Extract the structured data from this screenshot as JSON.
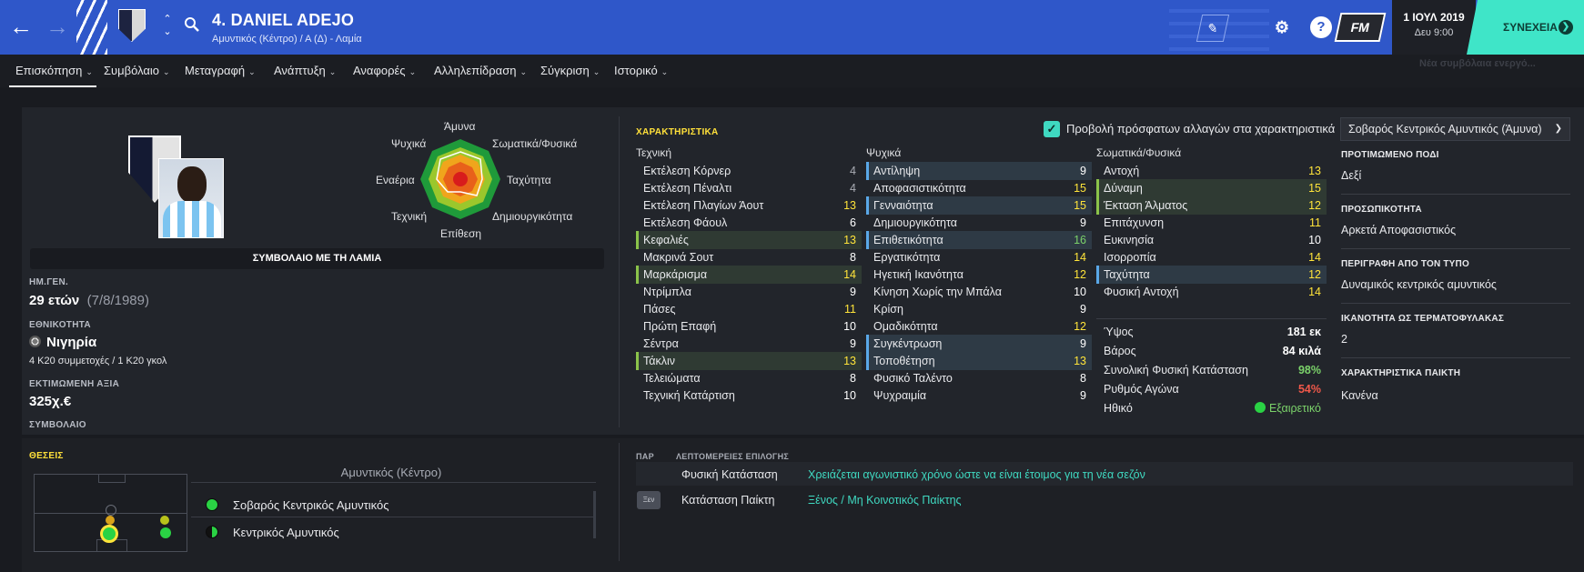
{
  "header": {
    "player_title": "4. DANIEL ADEJO",
    "subtitle": "Αμυντικός (Κέντρο) / Α (Δ) - Λαμία",
    "date": "1 ΙΟΥΛ 2019",
    "time": "Δευ 9:00",
    "continue_label": "ΣΥΝΕΧΕΙΑ",
    "fm_label": "FM",
    "help_label": "?",
    "notification": "Νέα συμβόλαια ενεργό..."
  },
  "tabs": [
    {
      "label": "Επισκόπηση"
    },
    {
      "label": "Συμβόλαιο"
    },
    {
      "label": "Μεταγραφή"
    },
    {
      "label": "Ανάπτυξη"
    },
    {
      "label": "Αναφορές"
    },
    {
      "label": "Αλληλεπίδραση"
    },
    {
      "label": "Σύγκριση"
    },
    {
      "label": "Ιστορικό"
    }
  ],
  "radar": {
    "labels": {
      "top": "Άμυνα",
      "top_right": "Σωματικά/Φυσικά",
      "right": "Ταχύτητα",
      "bottom_right": "Δημιουργικότητα",
      "bottom": "Επίθεση",
      "bottom_left": "Τεχνική",
      "left": "Εναέρια",
      "top_left": "Ψυχικά"
    }
  },
  "profile": {
    "contract_bar": "ΣΥΜΒΟΛΑΙΟ ΜΕ ΤΗ ΛΑΜΙΑ",
    "dob_label": "ΗΜ.ΓΕΝ.",
    "age": "29 ετών",
    "dob": "(7/8/1989)",
    "nationality_label": "ΕΘΝΙΚΟΤΗΤΑ",
    "nationality": "Νιγηρία",
    "caps": "4 Κ20 συμμετοχές / 1 Κ20 γκολ",
    "value_label": "ΕΚΤΙΜΩΜΕΝΗ ΑΞΙΑ",
    "value": "325χ.€",
    "contract_label": "ΣΥΜΒΟΛΑΙΟ"
  },
  "attributes": {
    "section_title": "ΧΑΡΑΚΤΗΡΙΣΤΙΚΑ",
    "show_changes_label": "Προβολή πρόσφατων αλλαγών στα χαρακτηριστικά",
    "role_select": "Σοβαρός Κεντρικός Αμυντικός (Άμυνα)",
    "technical_header": "Τεχνική",
    "mental_header": "Ψυχικά",
    "physical_header": "Σωματικά/Φυσικά",
    "technical": [
      {
        "name": "Εκτέλεση Κόρνερ",
        "value": "4"
      },
      {
        "name": "Εκτέλεση Πέναλτι",
        "value": "4"
      },
      {
        "name": "Εκτέλεση Πλαγίων Άουτ",
        "value": "13"
      },
      {
        "name": "Εκτέλεση Φάουλ",
        "value": "6"
      },
      {
        "name": "Κεφαλιές",
        "value": "13"
      },
      {
        "name": "Μακρινά Σουτ",
        "value": "8"
      },
      {
        "name": "Μαρκάρισμα",
        "value": "14"
      },
      {
        "name": "Ντρίμπλα",
        "value": "9"
      },
      {
        "name": "Πάσες",
        "value": "11"
      },
      {
        "name": "Πρώτη Επαφή",
        "value": "10"
      },
      {
        "name": "Σέντρα",
        "value": "9"
      },
      {
        "name": "Τάκλιν",
        "value": "13"
      },
      {
        "name": "Τελειώματα",
        "value": "8"
      },
      {
        "name": "Τεχνική Κατάρτιση",
        "value": "10"
      }
    ],
    "mental": [
      {
        "name": "Αντίληψη",
        "value": "9"
      },
      {
        "name": "Αποφασιστικότητα",
        "value": "15"
      },
      {
        "name": "Γενναιότητα",
        "value": "15"
      },
      {
        "name": "Δημιουργικότητα",
        "value": "9"
      },
      {
        "name": "Επιθετικότητα",
        "value": "16"
      },
      {
        "name": "Εργατικότητα",
        "value": "14"
      },
      {
        "name": "Ηγετική Ικανότητα",
        "value": "12"
      },
      {
        "name": "Κίνηση Χωρίς την Μπάλα",
        "value": "10"
      },
      {
        "name": "Κρίση",
        "value": "9"
      },
      {
        "name": "Ομαδικότητα",
        "value": "12"
      },
      {
        "name": "Συγκέντρωση",
        "value": "9"
      },
      {
        "name": "Τοποθέτηση",
        "value": "13"
      },
      {
        "name": "Φυσικό Ταλέντο",
        "value": "8"
      },
      {
        "name": "Ψυχραιμία",
        "value": "9"
      }
    ],
    "physical": [
      {
        "name": "Αντοχή",
        "value": "13"
      },
      {
        "name": "Δύναμη",
        "value": "15"
      },
      {
        "name": "Έκταση Άλματος",
        "value": "12"
      },
      {
        "name": "Επιτάχυνση",
        "value": "11"
      },
      {
        "name": "Ευκινησία",
        "value": "10"
      },
      {
        "name": "Ισορροπία",
        "value": "14"
      },
      {
        "name": "Ταχύτητα",
        "value": "12"
      },
      {
        "name": "Φυσική Αντοχή",
        "value": "14"
      }
    ],
    "stats": [
      {
        "name": "Ύψος",
        "value": "181 εκ"
      },
      {
        "name": "Βάρος",
        "value": "84 κιλά"
      },
      {
        "name": "Συνολική Φυσική Κατάσταση",
        "value": "98%"
      },
      {
        "name": "Ρυθμός Αγώνα",
        "value": "54%"
      },
      {
        "name": "Ηθικό",
        "value": "Εξαιρετικό"
      }
    ]
  },
  "right_info": {
    "foot_label": "ΠΡΟΤΙΜΩΜΕΝΟ ΠΟΔΙ",
    "foot": "Δεξί",
    "personality_label": "ΠΡΟΣΩΠΙΚΟΤΗΤΑ",
    "personality": "Αρκετά Αποφασιστικός",
    "media_label": "ΠΕΡΙΓΡΑΦΗ ΑΠΟ ΤΟΝ ΤΥΠΟ",
    "media": "Δυναμικός κεντρικός αμυντικός",
    "gk_label": "ΙΚΑΝΟΤΗΤΑ ΩΣ ΤΕΡΜΑΤΟΦΥΛΑΚΑΣ",
    "gk": "2",
    "traits_label": "ΧΑΡΑΚΤΗΡΙΣΤΙΚΑ ΠΑΙΚΤΗ",
    "traits": "Κανένα"
  },
  "positions": {
    "title": "ΘΕΣΕΙΣ",
    "position_name": "Αμυντικός (Κέντρο)",
    "roles": [
      {
        "label": "Σοβαρός Κεντρικός Αμυντικός"
      },
      {
        "label": "Κεντρικός Αμυντικός"
      }
    ]
  },
  "selection": {
    "col1": "ΠΑΡ",
    "col2": "ΛΕΠΤΟΜΕΡΕΙΕΣ ΕΠΙΛΟΓΗΣ",
    "rows": [
      {
        "badge": "",
        "label": "Φυσική Κατάσταση",
        "detail": "Χρειάζεται αγωνιστικό χρόνο ώστε να είναι έτοιμος για τη νέα σεζόν"
      },
      {
        "badge": "Ξεν",
        "label": "Κατάσταση Παίκτη",
        "detail": "Ξένος / Μη Κοινοτικός Παίκτης"
      }
    ]
  },
  "colors": {
    "header_blue": "#2f57c9",
    "accent_teal": "#3fe5c8",
    "highlight_yellow": "#ffe43a"
  }
}
